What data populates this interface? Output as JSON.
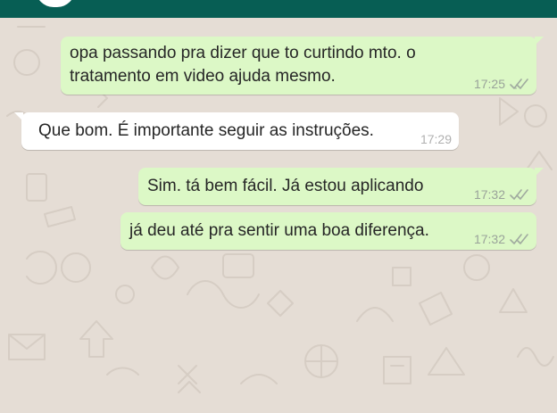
{
  "theme": {
    "header_color": "#075e54",
    "chat_background": "#e5ddd5",
    "outgoing_bubble": "#dcf8c6",
    "incoming_bubble": "#ffffff",
    "read_ticks_color": "#a0aa9f"
  },
  "messages": [
    {
      "direction": "outgoing",
      "lines": [
        "opa passando pra dizer que to curtindo mto. o",
        "tratamento em video ajuda mesmo."
      ],
      "time": "17:25",
      "status_icon": "double-check-icon"
    },
    {
      "direction": "incoming",
      "lines": [
        "Que bom. É importante seguir as instruções."
      ],
      "time": "17:29"
    },
    {
      "direction": "outgoing",
      "lines": [
        "Sim. tá bem fácil. Já estou aplicando"
      ],
      "time": "17:32",
      "status_icon": "double-check-icon"
    },
    {
      "direction": "outgoing",
      "lines": [
        "já deu até pra sentir uma boa diferença."
      ],
      "time": "17:32",
      "status_icon": "double-check-icon"
    }
  ]
}
